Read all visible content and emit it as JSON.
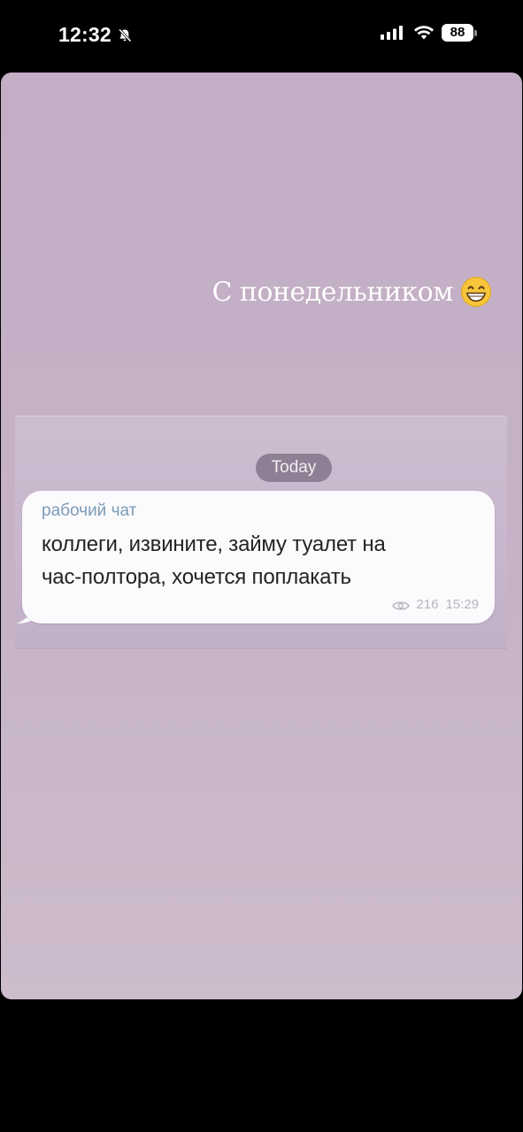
{
  "status_bar": {
    "time": "12:32",
    "silent_icon": "bell-slash-icon",
    "signal_icon": "cellular-signal-icon",
    "wifi_icon": "wifi-icon",
    "battery_level": "88"
  },
  "story": {
    "caption": "С понедельником",
    "caption_emoji": "grinning-face-emoji",
    "background_color": "#c6b2c7"
  },
  "chat": {
    "date_label": "Today",
    "sender": "рабочий чат",
    "line1": "коллеги, извините, займу туалет на",
    "line2": "час-полтора, хочется поплакать",
    "views": "216",
    "time": "15:29",
    "views_icon": "eye-icon"
  }
}
